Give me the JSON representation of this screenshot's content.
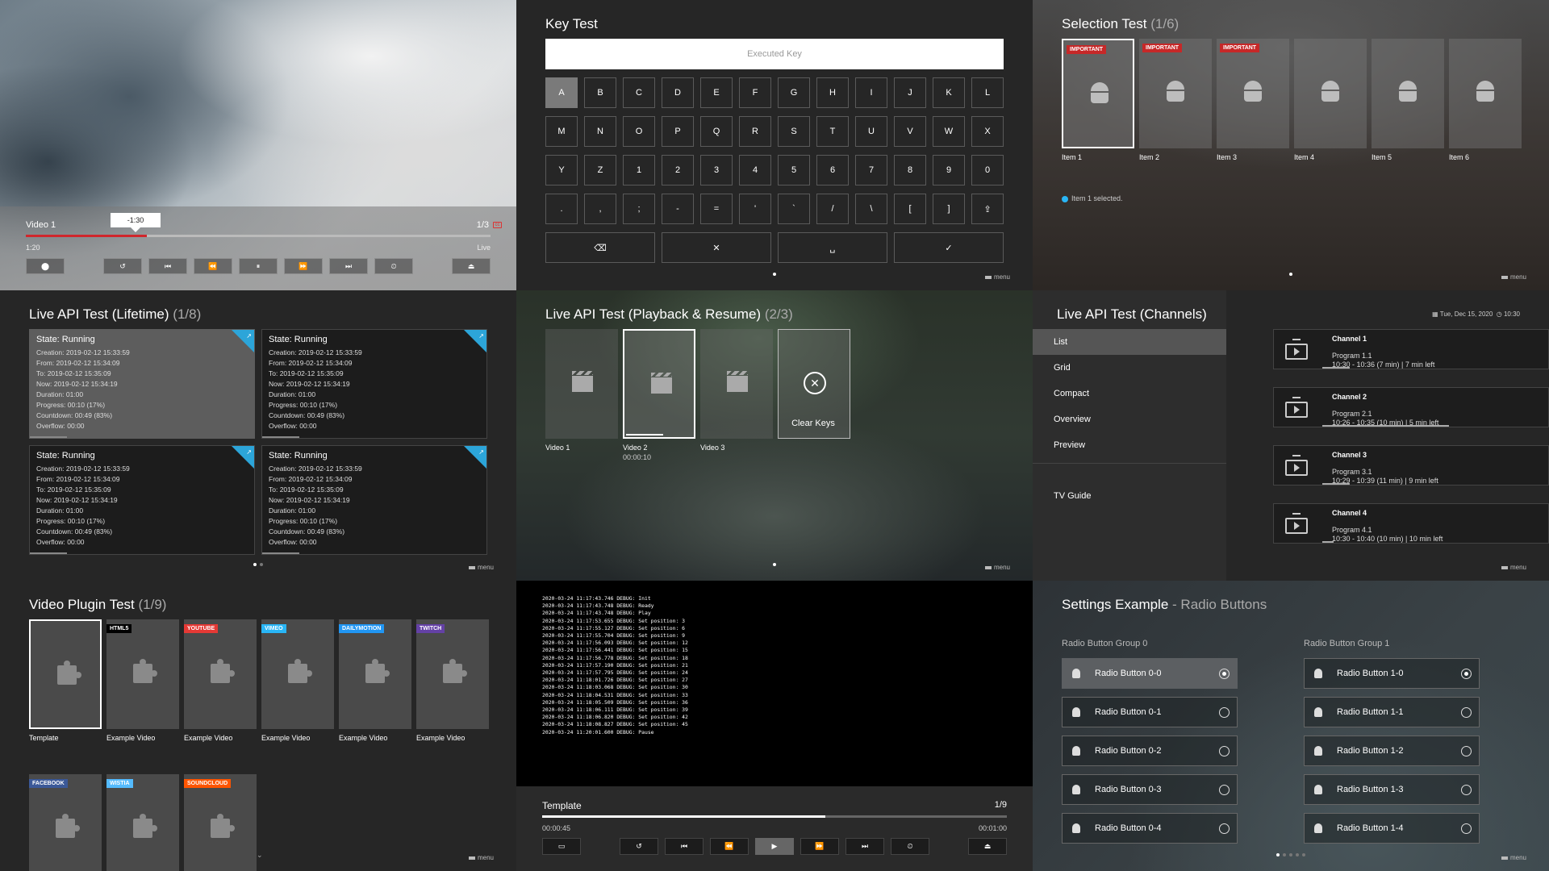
{
  "video": {
    "title": "Video 1",
    "count": "1/3",
    "tooltip": "-1:30",
    "time": "1:20",
    "live": "Live",
    "progress": 0.26,
    "buttons": [
      {
        "name": "record-button",
        "glyph": "⬤"
      },
      {
        "name": "replay-button",
        "glyph": "↺"
      },
      {
        "name": "skip-previous-button",
        "glyph": "⏮"
      },
      {
        "name": "rewind-button",
        "glyph": "⏪"
      },
      {
        "name": "pause-button",
        "glyph": "⏸"
      },
      {
        "name": "fast-forward-button",
        "glyph": "⏩"
      },
      {
        "name": "skip-next-button",
        "glyph": "⏭"
      },
      {
        "name": "timer-button",
        "glyph": "⏲"
      },
      {
        "name": "eject-button",
        "glyph": "⏏"
      }
    ]
  },
  "key_test": {
    "title": "Key Test",
    "placeholder": "Executed Key",
    "rows": [
      [
        "A",
        "B",
        "C",
        "D",
        "E",
        "F",
        "G",
        "H",
        "I",
        "J",
        "K",
        "L"
      ],
      [
        "M",
        "N",
        "O",
        "P",
        "Q",
        "R",
        "S",
        "T",
        "U",
        "V",
        "W",
        "X"
      ],
      [
        "Y",
        "Z",
        "1",
        "2",
        "3",
        "4",
        "5",
        "6",
        "7",
        "8",
        "9",
        "0"
      ],
      [
        ".",
        ",",
        ";",
        "-",
        "=",
        "'",
        "`",
        "/",
        "\\",
        "[",
        "]",
        "⇪"
      ]
    ],
    "bottom": [
      "⌫",
      "✕",
      "␣",
      "✓"
    ],
    "menu": "menu"
  },
  "selection": {
    "title": "Selection Test",
    "count": "(1/6)",
    "items": [
      {
        "label": "Item 1",
        "badge": "IMPORTANT"
      },
      {
        "label": "Item 2",
        "badge": "IMPORTANT"
      },
      {
        "label": "Item 3",
        "badge": "IMPORTANT"
      },
      {
        "label": "Item 4",
        "badge": ""
      },
      {
        "label": "Item 5",
        "badge": ""
      },
      {
        "label": "Item 6",
        "badge": ""
      }
    ],
    "status": "Item 1 selected.",
    "menu": "menu"
  },
  "lifetime": {
    "title": "Live API Test (Lifetime)",
    "count": "(1/8)",
    "cards": [
      {
        "state": "State: Running",
        "lines": [
          "Creation: 2019-02-12 15:33:59",
          "From: 2019-02-12 15:34:09",
          "To: 2019-02-12 15:35:09",
          "Now: 2019-02-12 15:34:19",
          "Duration: 01:00",
          "Progress: 00:10 (17%)",
          "Countdown: 00:49 (83%)",
          "Overflow: 00:00"
        ]
      },
      {
        "state": "State: Running",
        "lines": [
          "Creation: 2019-02-12 15:33:59",
          "From: 2019-02-12 15:34:09",
          "To: 2019-02-12 15:35:09",
          "Now: 2019-02-12 15:34:19",
          "Duration: 01:00",
          "Progress: 00:10 (17%)",
          "Countdown: 00:49 (83%)",
          "Overflow: 00:00"
        ]
      },
      {
        "state": "State: Running",
        "lines": [
          "Creation: 2019-02-12 15:33:59",
          "From: 2019-02-12 15:34:09",
          "To: 2019-02-12 15:35:09",
          "Now: 2019-02-12 15:34:19",
          "Duration: 01:00",
          "Progress: 00:10 (17%)",
          "Countdown: 00:49 (83%)",
          "Overflow: 00:00"
        ]
      },
      {
        "state": "State: Running",
        "lines": [
          "Creation: 2019-02-12 15:33:59",
          "From: 2019-02-12 15:34:09",
          "To: 2019-02-12 15:35:09",
          "Now: 2019-02-12 15:34:19",
          "Duration: 01:00",
          "Progress: 00:10 (17%)",
          "Countdown: 00:49 (83%)",
          "Overflow: 00:00"
        ]
      }
    ],
    "menu": "menu"
  },
  "playback": {
    "title": "Live API Test (Playback & Resume)",
    "count": "(2/3)",
    "items": [
      {
        "label": "Video 1",
        "sub": ""
      },
      {
        "label": "Video 2",
        "sub": "00:00:10"
      },
      {
        "label": "Video 3",
        "sub": ""
      }
    ],
    "clear_label": "Clear Keys",
    "menu": "menu"
  },
  "channels": {
    "title": "Live API Test (Channels)",
    "nav": [
      "List",
      "Grid",
      "Compact",
      "Overview",
      "Preview"
    ],
    "nav_extra": "TV Guide",
    "date": "Tue, Dec 15, 2020",
    "clock": "10:30",
    "rows": [
      {
        "name": "Channel 1",
        "program": "Program 1.1",
        "time": "10:30 - 10:36 (7 min) | 7 min left",
        "progress": 0.12
      },
      {
        "name": "Channel 2",
        "program": "Program 2.1",
        "time": "10:26 - 10:35 (10 min) | 5 min left",
        "progress": 0.56
      },
      {
        "name": "Channel 3",
        "program": "Program 3.1",
        "time": "10:29 - 10:39 (11 min) | 9 min left",
        "progress": 0.12
      },
      {
        "name": "Channel 4",
        "program": "Program 4.1",
        "time": "10:30 - 10:40 (10 min) | 10 min left",
        "progress": 0.05
      }
    ],
    "menu": "menu"
  },
  "plugins": {
    "title": "Video Plugin Test",
    "count": "(1/9)",
    "items": [
      {
        "badge": "",
        "label": "Template",
        "color": ""
      },
      {
        "badge": "HTML5",
        "label": "Example Video",
        "color": "#000000"
      },
      {
        "badge": "YOUTUBE",
        "label": "Example Video",
        "color": "#e53935"
      },
      {
        "badge": "VIMEO",
        "label": "Example Video",
        "color": "#29b6f6"
      },
      {
        "badge": "DAILYMOTION",
        "label": "Example Video",
        "color": "#2196f3"
      },
      {
        "badge": "TWITCH",
        "label": "Example Video",
        "color": "#6441a5"
      },
      {
        "badge": "FACEBOOK",
        "label": "",
        "color": "#3b5998"
      },
      {
        "badge": "WISTIA",
        "label": "",
        "color": "#54bbff"
      },
      {
        "badge": "SOUNDCLOUD",
        "label": "",
        "color": "#ff5500"
      }
    ],
    "chevron": "⌄",
    "menu": "menu"
  },
  "console": {
    "log": [
      "2020-03-24 11:17:43.746 DEBUG: Init",
      "2020-03-24 11:17:43.748 DEBUG: Ready",
      "2020-03-24 11:17:43.748 DEBUG: Play",
      "2020-03-24 11:17:53.655 DEBUG: Set position: 3",
      "2020-03-24 11:17:55.127 DEBUG: Set position: 6",
      "2020-03-24 11:17:55.704 DEBUG: Set position: 9",
      "2020-03-24 11:17:56.093 DEBUG: Set position: 12",
      "2020-03-24 11:17:56.441 DEBUG: Set position: 15",
      "2020-03-24 11:17:56.778 DEBUG: Set position: 18",
      "2020-03-24 11:17:57.190 DEBUG: Set position: 21",
      "2020-03-24 11:17:57.795 DEBUG: Set position: 24",
      "2020-03-24 11:18:01.726 DEBUG: Set position: 27",
      "2020-03-24 11:18:03.068 DEBUG: Set position: 30",
      "2020-03-24 11:18:04.531 DEBUG: Set position: 33",
      "2020-03-24 11:18:05.509 DEBUG: Set position: 36",
      "2020-03-24 11:18:06.111 DEBUG: Set position: 39",
      "2020-03-24 11:18:06.820 DEBUG: Set position: 42",
      "2020-03-24 11:18:08.827 DEBUG: Set position: 45",
      "2020-03-24 11:20:01.600 DEBUG: Pause"
    ],
    "title": "Template",
    "count": "1/9",
    "time": "00:00:45",
    "duration": "00:01:00",
    "progress": 0.61,
    "buttons": [
      {
        "name": "subtitles-button",
        "glyph": "▭"
      },
      {
        "name": "replay-button",
        "glyph": "↺"
      },
      {
        "name": "skip-previous-button",
        "glyph": "⏮"
      },
      {
        "name": "rewind-button",
        "glyph": "⏪"
      },
      {
        "name": "play-button",
        "glyph": "▶"
      },
      {
        "name": "fast-forward-button",
        "glyph": "⏩"
      },
      {
        "name": "skip-next-button",
        "glyph": "⏭"
      },
      {
        "name": "timer-button",
        "glyph": "⏲"
      },
      {
        "name": "eject-button",
        "glyph": "⏏"
      }
    ]
  },
  "settings": {
    "title": "Settings Example",
    "subtitle": "- Radio Buttons",
    "groups": [
      {
        "label": "Radio Button Group 0",
        "items": [
          "Radio Button 0-0",
          "Radio Button 0-1",
          "Radio Button 0-2",
          "Radio Button 0-3",
          "Radio Button 0-4"
        ],
        "selected": 0
      },
      {
        "label": "Radio Button Group 1",
        "items": [
          "Radio Button 1-0",
          "Radio Button 1-1",
          "Radio Button 1-2",
          "Radio Button 1-3",
          "Radio Button 1-4"
        ],
        "selected": 0
      }
    ],
    "menu": "menu"
  }
}
